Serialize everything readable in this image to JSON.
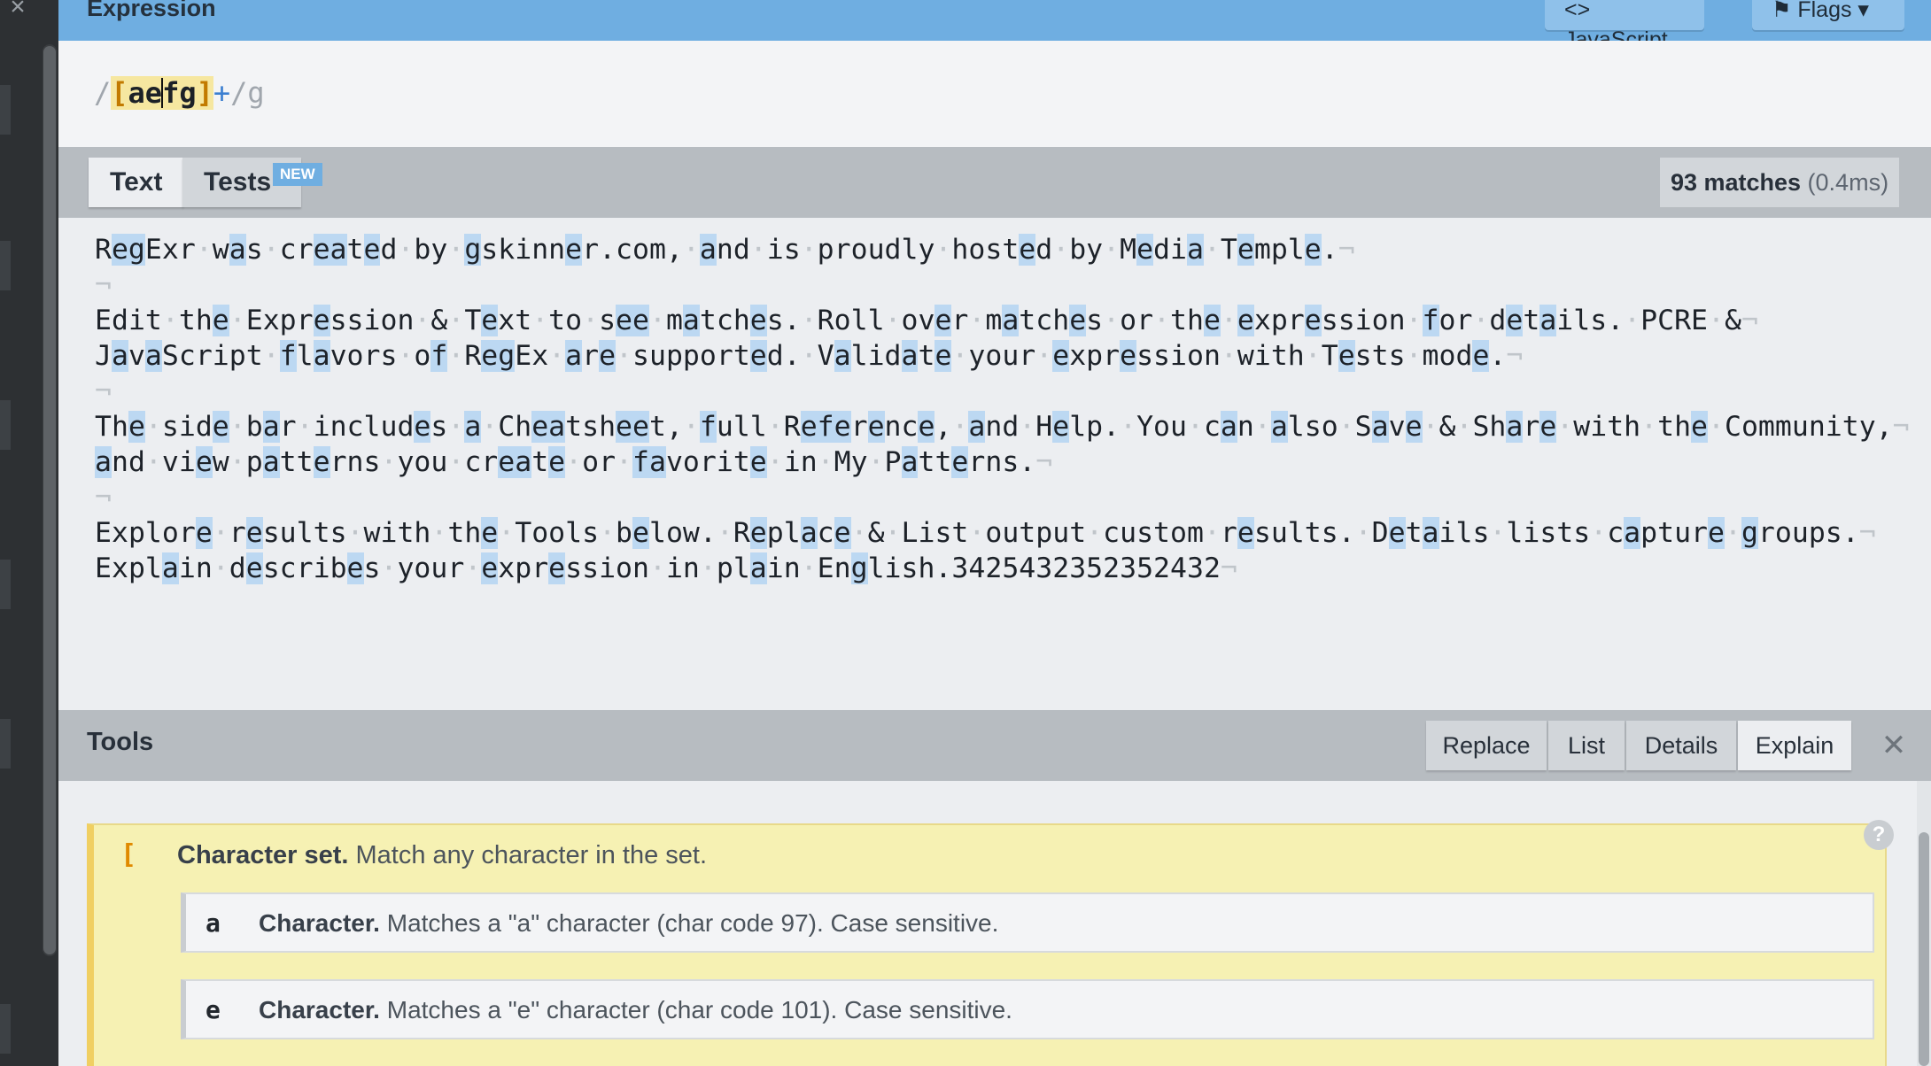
{
  "sidebar": {
    "close_icon": "×"
  },
  "expression": {
    "title": "Expression",
    "language_button": "<> JavaScript ▾",
    "flags_button": "⚑ Flags ▾",
    "open_delim": "/",
    "bracket_open": "[",
    "chars_before_caret": "ae",
    "chars_after_caret": "fg",
    "bracket_close": "]",
    "quantifier": "+",
    "close_delim": "/",
    "flags": "g"
  },
  "text_tabs": {
    "text_label": "Text",
    "tests_label": "Tests",
    "new_badge": "NEW",
    "matches_label": "93 matches",
    "time_label": "(0.4ms)"
  },
  "editor": {
    "lines": [
      "RegExr was created by gskinner.com, and is proudly hosted by Media Temple.",
      "",
      "Edit the Expression & Text to see matches. Roll over matches or the expression for details. PCRE &",
      "JavaScript flavors of RegEx are supported. Validate your expression with Tests mode.",
      "",
      "The side bar includes a Cheatsheet, full Reference, and Help. You can also Save & Share with the Community,",
      "and view patterns you create or favorite in My Patterns.",
      "",
      "Explore results with the Tools below. Replace & List output custom results. Details lists capture groups.",
      "Explain describes your expression in plain English.3425432352352432"
    ]
  },
  "tools": {
    "title": "Tools",
    "tabs": [
      "Replace",
      "List",
      "Details",
      "Explain"
    ],
    "active_tab": "Explain",
    "close_icon": "✕"
  },
  "explain": {
    "help_icon": "?",
    "charset": {
      "symbol": "[",
      "title": "Character set.",
      "text": "Match any character in the set."
    },
    "items": [
      {
        "symbol": "a",
        "title": "Character.",
        "text": "Matches a \"a\" character (char code 97). Case sensitive."
      },
      {
        "symbol": "e",
        "title": "Character.",
        "text": "Matches a \"e\" character (char code 101). Case sensitive."
      }
    ]
  },
  "colors": {
    "header_blue": "#6faee1",
    "match_highlight": "#bcd8f2",
    "charset_bg": "#f6f1b3"
  }
}
